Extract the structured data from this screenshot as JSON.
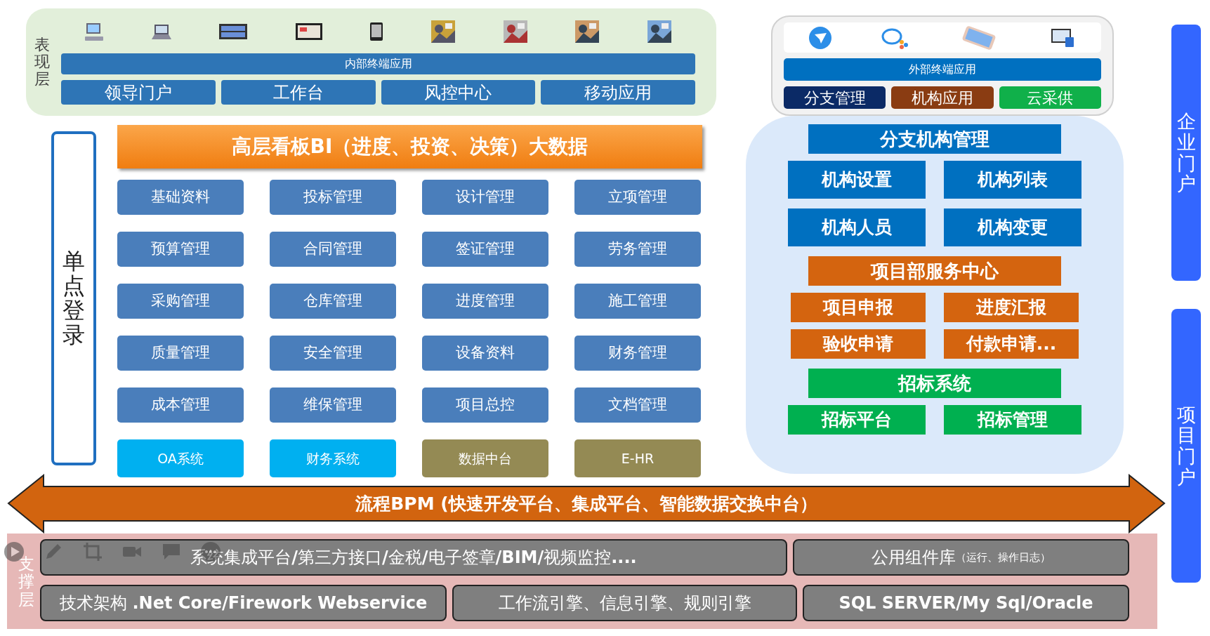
{
  "presentation_layer": {
    "label": "表现层",
    "bar": "内部终端应用",
    "items": [
      "领导门户",
      "工作台",
      "风控中心",
      "移动应用"
    ]
  },
  "external_layer": {
    "bar": "外部终端应用",
    "items": [
      {
        "label": "分支管理",
        "color": "#0b2a66"
      },
      {
        "label": "机构应用",
        "color": "#8a3c12"
      },
      {
        "label": "云采供",
        "color": "#10b04a"
      }
    ]
  },
  "sso": "单点登录",
  "bi_banner": "高层看板BI（进度、投资、决策）大数据",
  "modules": [
    {
      "label": "基础资料",
      "kind": "module"
    },
    {
      "label": "投标管理",
      "kind": "module"
    },
    {
      "label": "设计管理",
      "kind": "module"
    },
    {
      "label": "立项管理",
      "kind": "module"
    },
    {
      "label": "预算管理",
      "kind": "module"
    },
    {
      "label": "合同管理",
      "kind": "module"
    },
    {
      "label": "签证管理",
      "kind": "module"
    },
    {
      "label": "劳务管理",
      "kind": "module"
    },
    {
      "label": "采购管理",
      "kind": "module"
    },
    {
      "label": "仓库管理",
      "kind": "module"
    },
    {
      "label": "进度管理",
      "kind": "module"
    },
    {
      "label": "施工管理",
      "kind": "module"
    },
    {
      "label": "质量管理",
      "kind": "module"
    },
    {
      "label": "安全管理",
      "kind": "module"
    },
    {
      "label": "设备资料",
      "kind": "module"
    },
    {
      "label": "财务管理",
      "kind": "module"
    },
    {
      "label": "成本管理",
      "kind": "module"
    },
    {
      "label": "维保管理",
      "kind": "module"
    },
    {
      "label": "项目总控",
      "kind": "module"
    },
    {
      "label": "文档管理",
      "kind": "module"
    },
    {
      "label": "OA系统",
      "kind": "system"
    },
    {
      "label": "财务系统",
      "kind": "system"
    },
    {
      "label": "数据中台",
      "kind": "platform"
    },
    {
      "label": "E-HR",
      "kind": "platform"
    }
  ],
  "right_panel": {
    "sections": [
      {
        "title": "分支机构管理",
        "color": "#0070c0",
        "items": [
          "机构设置",
          "机构列表",
          "机构人员",
          "机构变更"
        ]
      },
      {
        "title": "项目部服务中心",
        "color": "#d4640f",
        "items": [
          "项目申报",
          "进度汇报",
          "验收申请",
          "付款申请..."
        ]
      },
      {
        "title": "招标系统",
        "color": "#00b050",
        "items": [
          "招标平台",
          "招标管理"
        ]
      }
    ]
  },
  "bpm": "流程BPM (快速开发平台、集成平台、智能数据交换中台）",
  "support_layer": {
    "label": "支撑层",
    "items": [
      {
        "title": "系统集成平台**/**第三方接口**/**金税**/**电子签章**/BIM/**视频监控**....**"
      },
      {
        "title": "公用组件库",
        "note": "（运行、操作日志）"
      },
      {
        "title": "技术架构 **.Net Core/Firework Webservice**"
      },
      {
        "title": "工作流引擎、信息引擎、规则引擎"
      },
      {
        "title": "**SQL SERVER/My Sql/Oracle**"
      }
    ]
  },
  "portals": [
    "企业门户",
    "项目门户"
  ]
}
